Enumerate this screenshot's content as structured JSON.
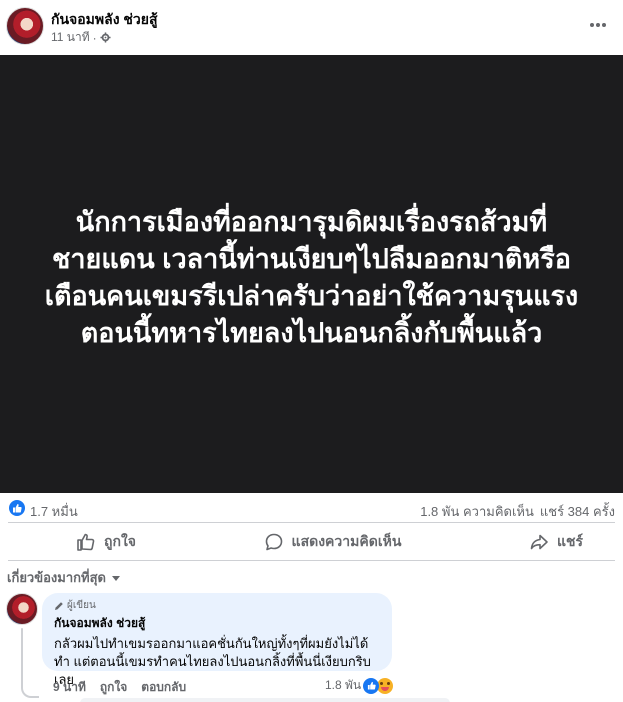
{
  "post": {
    "author": "กันจอมพลัง ช่วยสู้",
    "time": "11 นาที",
    "privacy_icon": "gear-icon",
    "image_text": "นักการเมืองที่ออกมารุมดิผมเรื่องรถส้วมที่ชายแดน เวลานี้ท่านเงียบๆไปลืมออกมาติหรือเตือนคนเขมรรีเปล่าครับว่าอย่าใช้ความรุนแรงตอนนี้ทหารไทยลงไปนอนกลิ้งกับพื้นแล้ว"
  },
  "stats": {
    "likes": "1.7 หมื่น",
    "comments": "1.8 พัน ความคิดเห็น",
    "shares": "แชร์ 384 ครั้ง"
  },
  "actions": {
    "like": "ถูกใจ",
    "comment": "แสดงความคิดเห็น",
    "share": "แชร์"
  },
  "sort": {
    "label": "เกี่ยวข้องมากที่สุด"
  },
  "comment": {
    "badge": "ผู้เขียน",
    "author": "กันจอมพลัง ช่วยสู้",
    "text": "กลัวผมไปทำเขมรออกมาแอคชั่นกันใหญ่ทั้งๆที่ผมยังไม่ได้ทำ แต่ตอนนี้เขมรทำคนไทยลงไปนอนกลิ้งที่พื้นนี่เงียบกริบเลย",
    "time": "9 นาที",
    "like": "ถูกใจ",
    "reply": "ตอบกลับ",
    "reaction_count": "1.8 พัน"
  },
  "colors": {
    "accent": "#1877f2",
    "image_bg": "#1c1c1e",
    "bubble_bg": "#e9f2fe",
    "muted": "#65676b"
  }
}
